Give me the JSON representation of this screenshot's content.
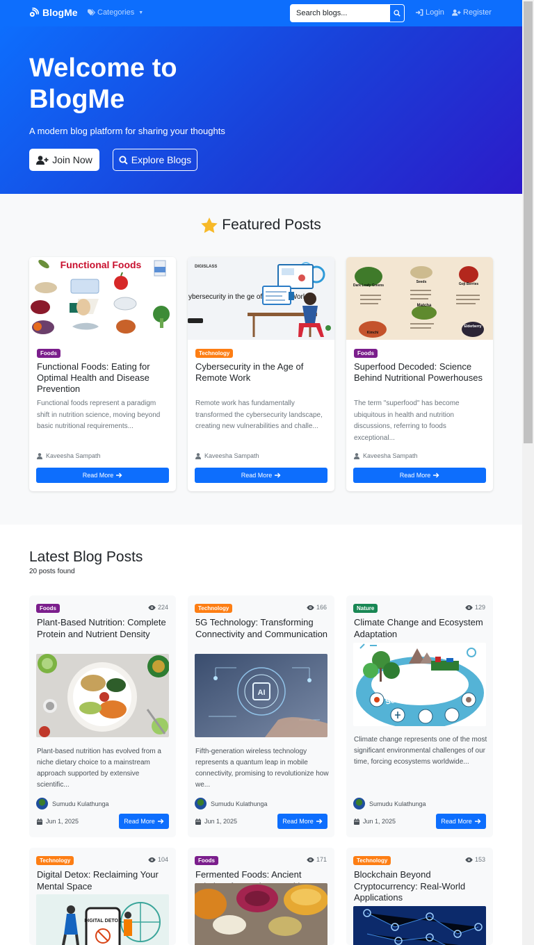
{
  "nav": {
    "brand": "BlogMe",
    "categories_label": "Categories",
    "search_placeholder": "Search blogs...",
    "login_label": "Login",
    "register_label": "Register"
  },
  "hero": {
    "title": "Welcome to BlogMe",
    "subtitle": "A modern blog platform for sharing your thoughts",
    "join_label": "Join Now",
    "explore_label": "Explore Blogs"
  },
  "featured": {
    "heading": "Featured Posts",
    "posts": [
      {
        "category": "Foods",
        "title": "Functional Foods: Eating for Optimal Health and Disease Prevention",
        "excerpt": "Functional foods represent a paradigm shift in nutrition science, moving beyond basic nutritional requirements...",
        "author": "Kaveesha Sampath",
        "read_more": "Read More",
        "image_heading": "Functional Foods"
      },
      {
        "category": "Technology",
        "title": "Cybersecurity in the Age of Remote Work",
        "excerpt": "Remote work has fundamentally transformed the cybersecurity landscape, creating new vulnerabilities and challe...",
        "author": "Kaveesha Sampath",
        "read_more": "Read More",
        "image_heading": "ybersecurity in the ge of Remote Work!",
        "image_logo": "DIGISLASS"
      },
      {
        "category": "Foods",
        "title": "Superfood Decoded: Science Behind Nutritional Powerhouses",
        "excerpt": "The term \"superfood\" has become ubiquitous in health and nutrition discussions, referring to foods exceptional...",
        "author": "Kaveesha Sampath",
        "read_more": "Read More",
        "image_labels": [
          "Dark Leafy Greens",
          "Seeds",
          "Goji Berries",
          "Matcha",
          "Kimchi",
          "Elderberry"
        ]
      }
    ]
  },
  "latest": {
    "heading": "Latest Blog Posts",
    "count": "20 posts found",
    "posts": [
      {
        "category": "Foods",
        "views": "224",
        "title": "Plant-Based Nutrition: Complete Protein and Nutrient Density",
        "excerpt": "Plant-based nutrition has evolved from a niche dietary choice to a mainstream approach supported by extensive scientific...",
        "author": "Sumudu Kulathunga",
        "date": "Jun 1, 2025",
        "read_more": "Read More"
      },
      {
        "category": "Technology",
        "views": "166",
        "title": "5G Technology: Transforming Connectivity and Communication",
        "excerpt": "Fifth-generation wireless technology represents a quantum leap in mobile connectivity, promising to revolutionize how we...",
        "author": "Sumudu Kulathunga",
        "date": "Jun 1, 2025",
        "read_more": "Read More",
        "image_text": "AI"
      },
      {
        "category": "Nature",
        "views": "129",
        "title": "Climate Change and Ecosystem Adaptation",
        "excerpt": "Climate change represents one of the most significant environmental challenges of our time, forcing ecosystems worldwide...",
        "author": "Sumudu Kulathunga",
        "date": "Jun 1, 2025",
        "read_more": "Read More",
        "image_text": "Societal Challenges"
      },
      {
        "category": "Technology",
        "views": "104",
        "title": "Digital Detox: Reclaiming Your Mental Space",
        "image_text": "DIGITAL DETOX"
      },
      {
        "category": "Foods",
        "views": "171",
        "title": "Fermented Foods: Ancient Wisdom for Modern Health"
      },
      {
        "category": "Technology",
        "views": "153",
        "title": "Blockchain Beyond Cryptocurrency: Real-World Applications"
      }
    ]
  },
  "colors": {
    "primary": "#0d6efd",
    "foods_badge": "#7b1e8c",
    "technology_badge": "#fd7e14",
    "nature_badge": "#198754"
  }
}
